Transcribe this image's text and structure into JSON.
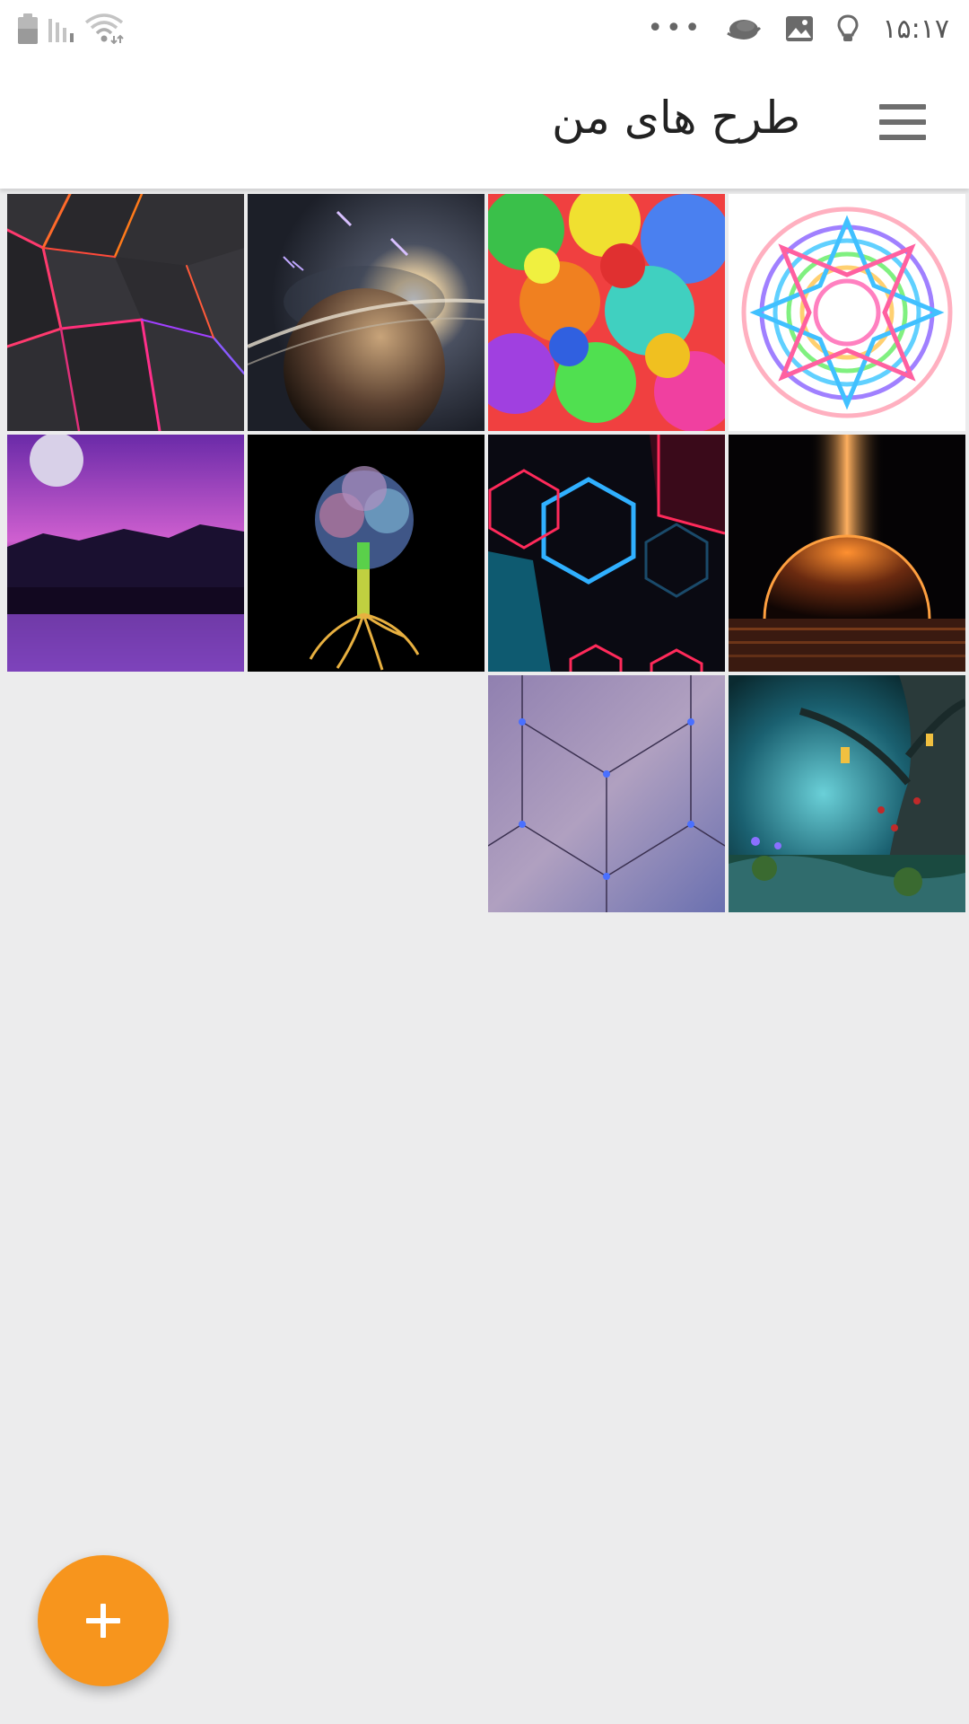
{
  "status_bar": {
    "time": "۱۵:۱۷",
    "more_indicator": "•••",
    "icons": [
      "battery-icon",
      "signal-icon",
      "wifi-icon",
      "cloud-icon",
      "image-icon",
      "bulb-icon"
    ]
  },
  "app_bar": {
    "title": "طرح های من",
    "menu_icon": "menu-icon"
  },
  "gallery": {
    "tiles": [
      {
        "name": "neon-polygons-design"
      },
      {
        "name": "saturn-space-design"
      },
      {
        "name": "rainbow-splash-design"
      },
      {
        "name": "kaleidoscope-design"
      },
      {
        "name": "purple-moon-lake-design"
      },
      {
        "name": "rainbow-tree-design"
      },
      {
        "name": "neon-hexagons-design"
      },
      {
        "name": "glowing-planet-design"
      },
      {
        "name": "blue-cube-lines-design"
      },
      {
        "name": "enchanted-forest-design"
      }
    ]
  },
  "fab": {
    "icon": "plus-icon",
    "accent_color": "#f7951d"
  },
  "colors": {
    "background": "#ececed",
    "app_bar": "#ffffff"
  }
}
